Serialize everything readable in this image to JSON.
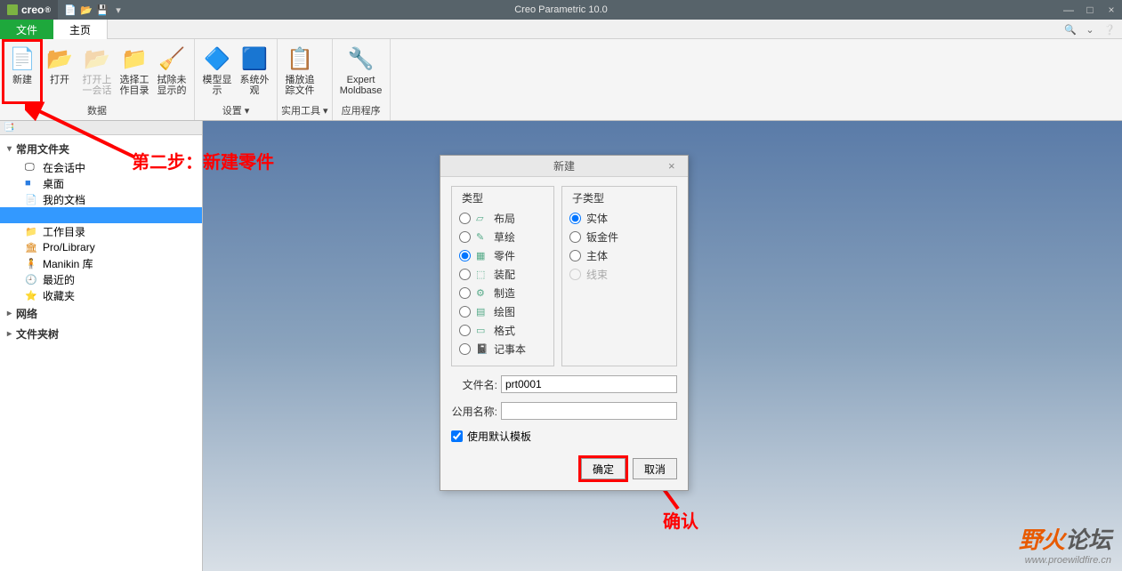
{
  "titlebar": {
    "app": "creo",
    "title": "Creo Parametric 10.0"
  },
  "tabs": {
    "file": "文件",
    "home": "主页"
  },
  "ribbon": {
    "new": "新建",
    "open": "打开",
    "open_last": "打开上一会话",
    "select_wd": "选择工作目录",
    "erase": "拭除未显示的",
    "group_data": "数据",
    "model_disp": "模型显示",
    "sys_appear": "系统外观",
    "group_settings": "设置 ▾",
    "play_trail": "播放追踪文件",
    "group_utils": "实用工具 ▾",
    "expert": "Expert Moldbase",
    "group_apps": "应用程序"
  },
  "sidebar": {
    "common_folders": "常用文件夹",
    "items": [
      {
        "label": "在会话中",
        "icon": "🖵"
      },
      {
        "label": "桌面",
        "icon": "🖥"
      },
      {
        "label": "我的文档",
        "icon": "📄"
      },
      {
        "label": "",
        "icon": ""
      },
      {
        "label": "工作目录",
        "icon": "📁"
      },
      {
        "label": "Pro/Library",
        "icon": "📚"
      },
      {
        "label": "Manikin 库",
        "icon": "🧍"
      },
      {
        "label": "最近的",
        "icon": "🕘"
      },
      {
        "label": "收藏夹",
        "icon": "⭐"
      }
    ],
    "network": "网络",
    "folder_tree": "文件夹树"
  },
  "annotations": {
    "step2": "第二步：新建零件",
    "confirm": "确认"
  },
  "dialog": {
    "title": "新建",
    "type_label": "类型",
    "subtype_label": "子类型",
    "types": [
      {
        "label": "布局",
        "checked": false
      },
      {
        "label": "草绘",
        "checked": false
      },
      {
        "label": "零件",
        "checked": true
      },
      {
        "label": "装配",
        "checked": false
      },
      {
        "label": "制造",
        "checked": false
      },
      {
        "label": "绘图",
        "checked": false
      },
      {
        "label": "格式",
        "checked": false
      },
      {
        "label": "记事本",
        "checked": false
      }
    ],
    "subtypes": [
      {
        "label": "实体",
        "checked": true,
        "disabled": false
      },
      {
        "label": "钣金件",
        "checked": false,
        "disabled": false
      },
      {
        "label": "主体",
        "checked": false,
        "disabled": false
      },
      {
        "label": "线束",
        "checked": false,
        "disabled": true
      }
    ],
    "filename_label": "文件名:",
    "filename_value": "prt0001",
    "commonname_label": "公用名称:",
    "commonname_value": "",
    "use_default_template": "使用默认模板",
    "ok": "确定",
    "cancel": "取消"
  },
  "watermark": {
    "text": "野火论坛",
    "url": "www.proewildfire.cn"
  }
}
